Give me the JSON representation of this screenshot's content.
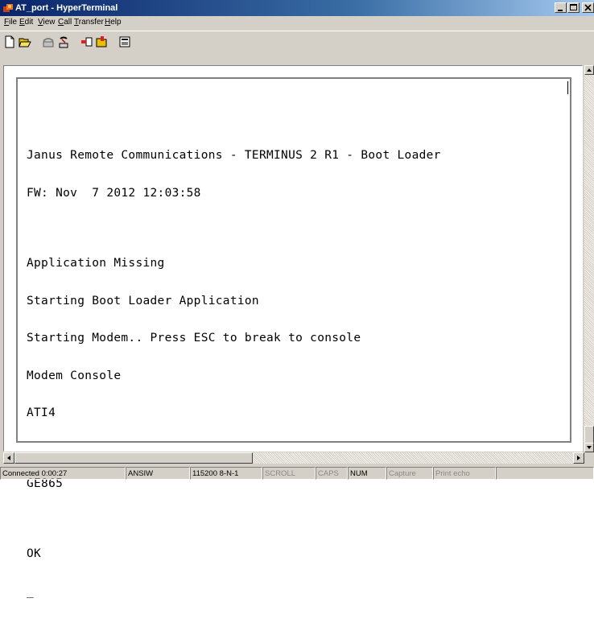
{
  "window": {
    "title": "AT_port - HyperTerminal"
  },
  "menu": [
    {
      "pre": "",
      "acc": "F",
      "post": "ile"
    },
    {
      "pre": "",
      "acc": "E",
      "post": "dit"
    },
    {
      "pre": "",
      "acc": "V",
      "post": "iew"
    },
    {
      "pre": "",
      "acc": "C",
      "post": "all"
    },
    {
      "pre": "",
      "acc": "T",
      "post": "ransfer"
    },
    {
      "pre": "",
      "acc": "H",
      "post": "elp"
    }
  ],
  "toolbar": [
    "new-icon",
    "open-icon",
    "connect-icon",
    "disconnect-icon",
    "send-icon",
    "receive-icon",
    "properties-icon"
  ],
  "terminal": {
    "lines": [
      "Janus Remote Communications - TERMINUS 2 R1 - Boot Loader",
      "FW: Nov  7 2012 12:03:58",
      "",
      "Application Missing",
      "Starting Boot Loader Application",
      "Starting Modem.. Press ESC to break to console",
      "Modem Console",
      "ATI4",
      "",
      "GE865",
      "",
      "OK",
      "_"
    ]
  },
  "status": {
    "connected": "Connected 0:00:27",
    "emulation": "ANSIW",
    "settings": "115200 8-N-1",
    "scroll": "SCROLL",
    "caps": "CAPS",
    "num": "NUM",
    "capture": "Capture",
    "print_echo": "Print echo"
  },
  "colors": {
    "titlebar_start": "#0a246a",
    "face": "#d4d0c8"
  }
}
